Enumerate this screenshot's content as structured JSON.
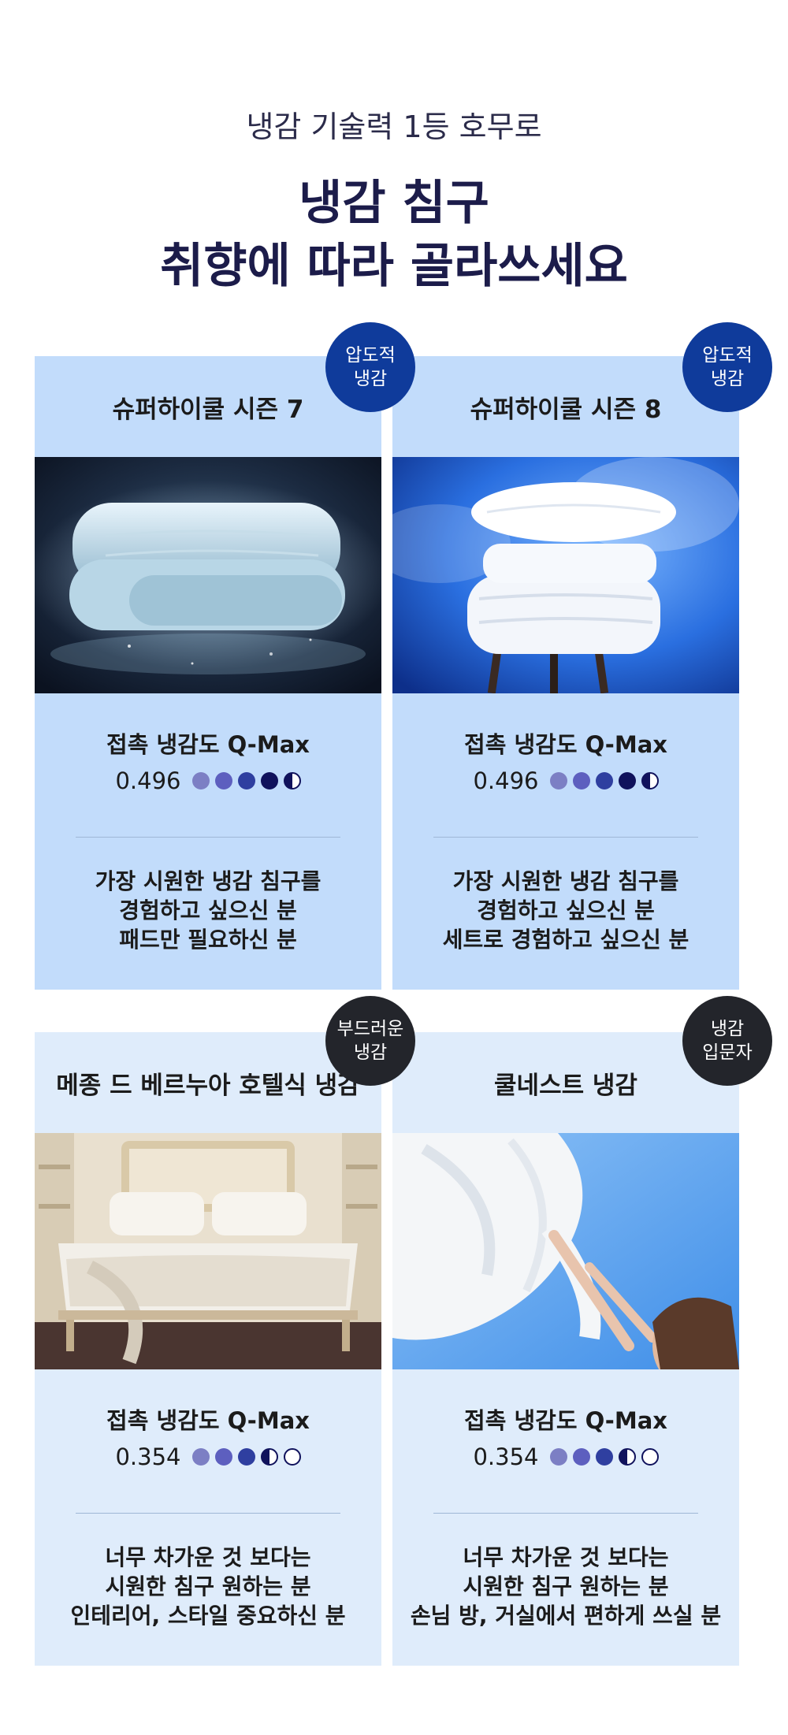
{
  "header": {
    "subtitle": "냉감 기술력 1등 호무로",
    "title_line1": "냉감 침구",
    "title_line2": "취향에 따라 골라쓰세요"
  },
  "colors": {
    "card_strong_bg": "#c2dcfb",
    "card_light_bg": "#dfecfb",
    "badge_blue": "#0f3b9b",
    "badge_dark": "#23252b",
    "dot_1": "#7c7fc4",
    "dot_2": "#5d5fbf",
    "dot_3": "#2f3fa0",
    "dot_4": "#10125c"
  },
  "cards": [
    {
      "badge_line1": "압도적",
      "badge_line2": "냉감",
      "name": "슈퍼하이쿨 시즌 7",
      "image": "folded-cooling-blanket-image",
      "metric_label": "접촉 냉감도 Q-Max",
      "qmax_value": "0.496",
      "rating": 4.5,
      "rating_max": 5,
      "desc_line1": "가장 시원한 냉감 침구를",
      "desc_line2": "경험하고 싶으신 분",
      "desc_line3": "패드만 필요하신 분"
    },
    {
      "badge_line1": "압도적",
      "badge_line2": "냉감",
      "name": "슈퍼하이쿨 시즌 8",
      "image": "stacked-bedding-on-stool-image",
      "metric_label": "접촉 냉감도 Q-Max",
      "qmax_value": "0.496",
      "rating": 4.5,
      "rating_max": 5,
      "desc_line1": "가장 시원한 냉감 침구를",
      "desc_line2": "경험하고 싶으신 분",
      "desc_line3": "세트로 경험하고 싶으신 분"
    },
    {
      "badge_line1": "부드러운",
      "badge_line2": "냉감",
      "name": "메종 드 베르누아 호텔식 냉감",
      "image": "hotel-bedroom-image",
      "metric_label": "접촉 냉감도 Q-Max",
      "qmax_value": "0.354",
      "rating": 3.5,
      "rating_max": 5,
      "desc_line1": "너무 차가운 것 보다는",
      "desc_line2": "시원한 침구 원하는 분",
      "desc_line3": "인테리어, 스타일 중요하신 분"
    },
    {
      "badge_line1": "냉감",
      "badge_line2": "입문자",
      "name": "쿨네스트 냉감",
      "image": "woman-with-flowing-sheet-image",
      "metric_label": "접촉 냉감도 Q-Max",
      "qmax_value": "0.354",
      "rating": 3.5,
      "rating_max": 5,
      "desc_line1": "너무 차가운 것 보다는",
      "desc_line2": "시원한 침구 원하는 분",
      "desc_line3": "손님 방, 거실에서 편하게 쓰실 분"
    }
  ]
}
